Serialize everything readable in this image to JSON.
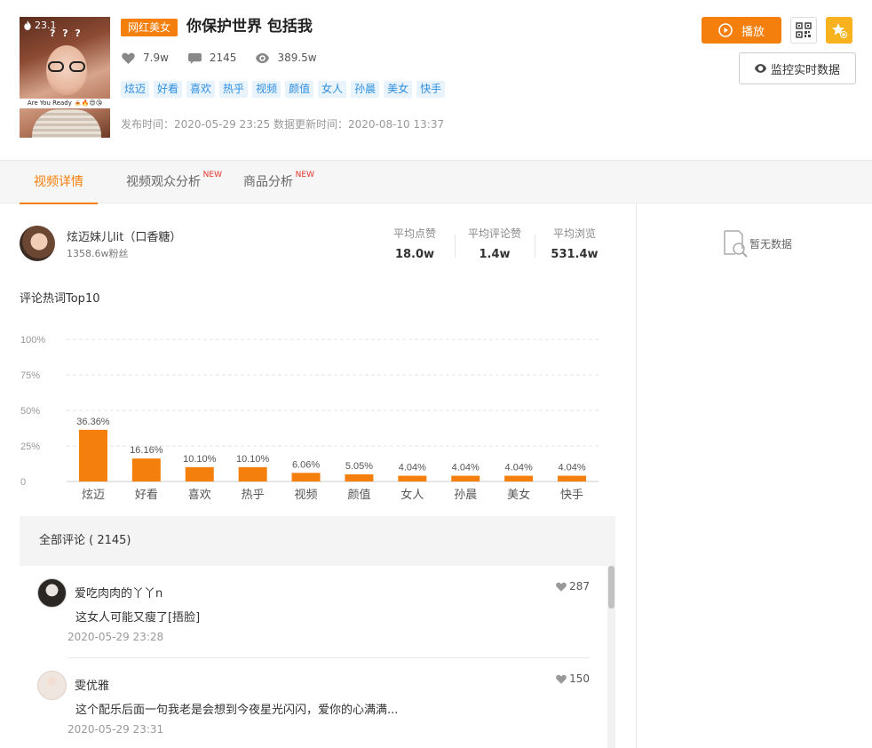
{
  "video": {
    "hot_value": "23.1",
    "cover_caption": "Are You Ready 🍝🔥😍😘",
    "category_tag": "网红美女",
    "title": "你保护世界 包括我",
    "likes": "7.9w",
    "comments": "2145",
    "views": "389.5w",
    "tags": [
      "炫迈",
      "好看",
      "喜欢",
      "热乎",
      "视频",
      "颜值",
      "女人",
      "孙晨",
      "美女",
      "快手"
    ],
    "publish_info": "发布时间：2020-05-29 23:25 数据更新时间：2020-08-10 13:37"
  },
  "actions": {
    "play_label": "播放",
    "monitor_label": "监控实时数据"
  },
  "tabs": [
    {
      "label": "视频详情",
      "active": true,
      "badge": ""
    },
    {
      "label": "视频观众分析",
      "active": false,
      "badge": "NEW"
    },
    {
      "label": "商品分析",
      "active": false,
      "badge": "NEW"
    }
  ],
  "author": {
    "name": "炫迈妹儿lit（口香糖）",
    "fans": "1358.6w粉丝",
    "metrics": [
      {
        "label": "平均点赞",
        "value": "18.0w"
      },
      {
        "label": "平均评论赞",
        "value": "1.4w"
      },
      {
        "label": "平均浏览",
        "value": "531.4w"
      }
    ]
  },
  "keywords_title": "评论热词Top10",
  "chart_data": {
    "type": "bar",
    "categories": [
      "炫迈",
      "好看",
      "喜欢",
      "热乎",
      "视频",
      "颜值",
      "女人",
      "孙晨",
      "美女",
      "快手"
    ],
    "values": [
      36.36,
      16.16,
      10.1,
      10.1,
      6.06,
      5.05,
      4.04,
      4.04,
      4.04,
      4.04
    ],
    "value_labels": [
      "36.36%",
      "16.16%",
      "10.10%",
      "10.10%",
      "6.06%",
      "5.05%",
      "4.04%",
      "4.04%",
      "4.04%",
      "4.04%"
    ],
    "yticks": [
      "0",
      "25%",
      "50%",
      "75%",
      "100%"
    ],
    "ylim": [
      0,
      100
    ],
    "bar_color": "#f57f0c",
    "grid": true
  },
  "comments": {
    "header": "全部评论 ( 2145)",
    "items": [
      {
        "user": "爱吃肉肉的丫丫n",
        "text": "这女人可能又瘦了[捂脸]",
        "time": "2020-05-29 23:28",
        "likes": "287"
      },
      {
        "user": "雯优雅",
        "text": "这个配乐后面一句我老是会想到今夜星光闪闪，爱你的心满满...",
        "time": "2020-05-29 23:31",
        "likes": "150"
      }
    ]
  },
  "side_empty": "暂无数据",
  "colors": {
    "accent": "#f57f0c",
    "tag_bg": "#e9f3fc",
    "tag_text": "#2e8fe0",
    "fav": "#f7b21d"
  }
}
